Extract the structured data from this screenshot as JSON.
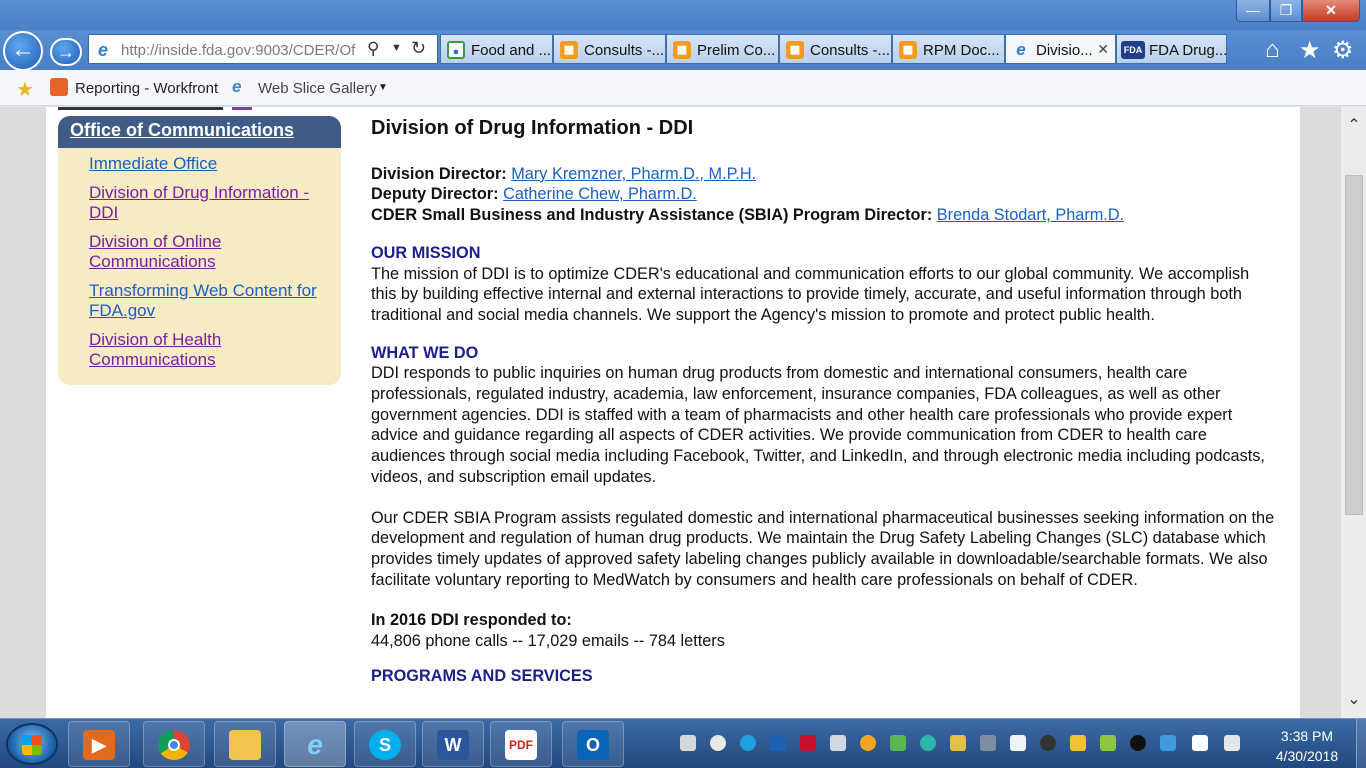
{
  "browser": {
    "address": "http://inside.fda.gov:9003/CDER/Of",
    "tabs": [
      {
        "label": "Food and ...",
        "icon": "chrome-globe-icon",
        "active": false
      },
      {
        "label": "Consults -...",
        "icon": "workfront-icon",
        "active": false
      },
      {
        "label": "Prelim Co...",
        "icon": "workfront-icon",
        "active": false
      },
      {
        "label": "Consults -...",
        "icon": "workfront-icon",
        "active": false
      },
      {
        "label": "RPM Doc...",
        "icon": "workfront-icon",
        "active": false
      },
      {
        "label": "Divisio...",
        "icon": "ie-icon",
        "active": true
      },
      {
        "label": "FDA Drug...",
        "icon": "fda-icon",
        "active": false
      }
    ],
    "favorites": {
      "reporting": "Reporting - Workfront",
      "web_slice": "Web Slice Gallery"
    }
  },
  "sidebar": {
    "title": "Office of Communications",
    "items": [
      {
        "label": "Immediate Office",
        "visited": false
      },
      {
        "label": "Division of Drug Information - DDI",
        "visited": true
      },
      {
        "label": "Division of Online Communications",
        "visited": true
      },
      {
        "label": "Transforming Web Content for FDA.gov",
        "visited": false
      },
      {
        "label": "Division of Health Communications",
        "visited": true
      }
    ]
  },
  "main": {
    "title": "Division of Drug Information - DDI",
    "staff": [
      {
        "role": "Division Director:",
        "name": "Mary Kremzner, Pharm.D., M.P.H."
      },
      {
        "role": "Deputy Director:",
        "name": "Catherine Chew, Pharm.D."
      },
      {
        "role": "CDER Small Business and Industry Assistance (SBIA) Program Director:",
        "name": "Brenda Stodart, Pharm.D."
      }
    ],
    "mission_heading": "OUR MISSION",
    "mission_text": "The mission of DDI is to optimize CDER's educational and communication efforts to our global community. We accomplish this by building effective internal and external interactions to provide timely, accurate, and useful information through both traditional and social media channels. We support the Agency's mission to promote and protect public health.",
    "whatwedo_heading": "WHAT WE DO",
    "whatwedo_text": "DDI responds to public inquiries on human drug products from domestic and international consumers, health care professionals, regulated industry, academia, law enforcement, insurance companies, FDA colleagues, as well as other government agencies. DDI is staffed with a team of pharmacists and other health care professionals who provide expert advice and guidance regarding all aspects of CDER activities. We provide communication from CDER to health care audiences through social media including Facebook, Twitter, and LinkedIn, and through electronic media including podcasts, videos, and subscription email updates.",
    "sbia_text": "Our CDER SBIA Program assists regulated domestic and international pharmaceutical businesses seeking information on the development and regulation of human drug products. We maintain the Drug Safety Labeling Changes (SLC) database which provides timely updates of approved safety labeling changes publicly available in downloadable/searchable formats. We also facilitate voluntary reporting to MedWatch by consumers and health care professionals on behalf of CDER.",
    "stats_heading": "In 2016 DDI responded to:",
    "stats_text": "44,806 phone calls -- 17,029 emails -- 784 letters",
    "programs_heading": "PROGRAMS AND SERVICES"
  },
  "taskbar": {
    "apps": [
      "media-player",
      "chrome",
      "file-explorer",
      "internet-explorer",
      "skype",
      "word",
      "acrobat",
      "outlook"
    ],
    "time": "3:38 PM",
    "date": "4/30/2018"
  },
  "colors": {
    "sidebar_header": "#3f5b86",
    "sidebar_bg": "#f6ebc3",
    "section_heading": "#1a1f8c",
    "link": "#1b5fc0",
    "visited_link": "#7b1fa2"
  }
}
